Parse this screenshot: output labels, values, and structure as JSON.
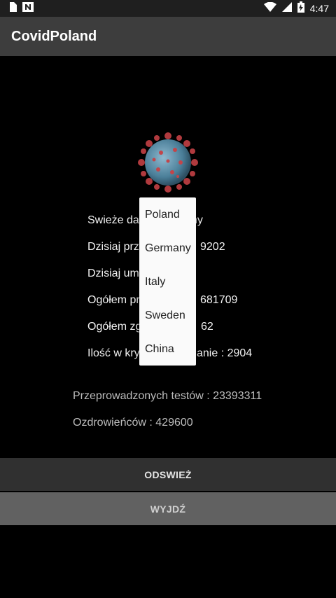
{
  "status_bar": {
    "time": "4:47"
  },
  "app_bar": {
    "title": "CovidPoland"
  },
  "stats": [
    {
      "label": "Swieże dane z dnia: 29.10.2020, godzina",
      "visible": "Swieże da",
      "tail": "ny"
    },
    {
      "visible_left": "Dzisiaj prz",
      "visible_right": "9202"
    },
    {
      "visible_left": "Dzisiaj um"
    },
    {
      "visible_left": "Ogółem pr",
      "visible_right": "681709"
    },
    {
      "visible_left": "Ogółem zg",
      "visible_right": "62"
    },
    {
      "visible_left": "Ilość w kry",
      "visible_right": "anie : 2904"
    }
  ],
  "tests_label": "Przeprowadzonych testów : 23393311",
  "recovered_label": "Ozdrowieńców : 429600",
  "dropdown": {
    "options": [
      "Poland",
      "Germany",
      "Italy",
      "Sweden",
      "China"
    ]
  },
  "buttons": {
    "refresh": "ODSWIEŻ",
    "exit": "WYJDŹ"
  }
}
